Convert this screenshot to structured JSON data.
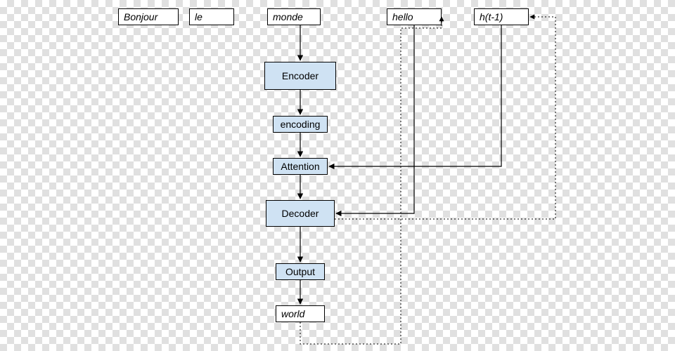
{
  "nodes": {
    "bonjour": {
      "label": "Bonjour"
    },
    "le": {
      "label": "le"
    },
    "monde": {
      "label": "monde"
    },
    "hello": {
      "label": "hello"
    },
    "ht1": {
      "label": "h(t-1)"
    },
    "encoder": {
      "label": "Encoder"
    },
    "encoding": {
      "label": "encoding"
    },
    "attention": {
      "label": "Attention"
    },
    "decoder": {
      "label": "Decoder"
    },
    "output": {
      "label": "Output"
    },
    "world": {
      "label": "world"
    }
  }
}
